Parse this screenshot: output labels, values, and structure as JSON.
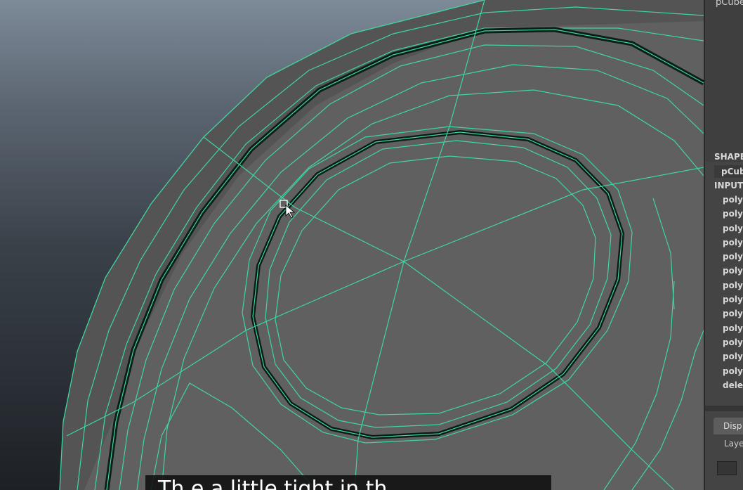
{
  "channel_box": {
    "object_name": "pCube",
    "shapes_header": "SHAPE",
    "shape_item": "pCub",
    "inputs_header": "INPUT",
    "inputs": [
      "polyl",
      "polyl",
      "polyl",
      "polyS",
      "polyT",
      "polyl",
      "polyl",
      "polyl",
      "polyS",
      "polyS",
      "polyS",
      "polyl",
      "polyl",
      "delet"
    ],
    "display_tab": "Disp",
    "layers_menu": "Layer"
  },
  "viewport": {
    "wire_color": "#3fd6a0",
    "mesh_color": "#5f5f5f",
    "caption": "Th        e a little tight in th"
  }
}
